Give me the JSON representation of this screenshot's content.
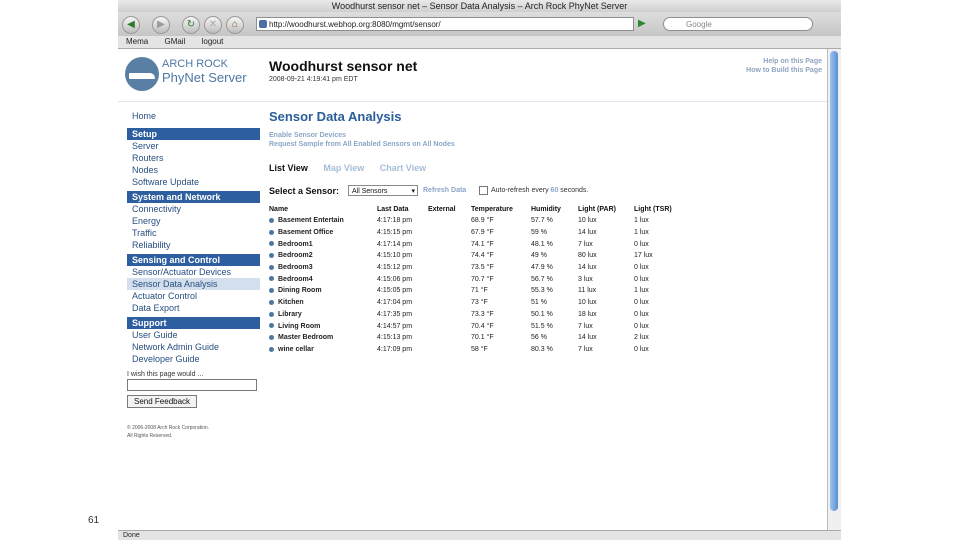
{
  "slide_number": "61",
  "browser": {
    "window_title": "Woodhurst sensor net – Sensor Data Analysis – Arch Rock PhyNet Server",
    "url": "http://woodhurst.webhop.org:8080/mgmt/sensor/",
    "search_placeholder": "Google",
    "bookmarks": [
      "Mema",
      "GMail",
      "logout"
    ],
    "status": "Done"
  },
  "header": {
    "logo_line1": "ARCH ROCK",
    "logo_line2": "PhyNet Server",
    "site_title": "Woodhurst sensor net",
    "timestamp": "2008-09-21 4:19:41 pm EDT",
    "help_links": [
      "Help on this Page",
      "How to Build this Page"
    ]
  },
  "sidebar": {
    "home": "Home",
    "sections": [
      {
        "title": "Setup",
        "items": [
          "Server",
          "Routers",
          "Nodes",
          "Software Update"
        ]
      },
      {
        "title": "System and Network",
        "items": [
          "Connectivity",
          "Energy",
          "Traffic",
          "Reliability"
        ]
      },
      {
        "title": "Sensing and Control",
        "items": [
          "Sensor/Actuator Devices",
          "Sensor Data Analysis",
          "Actuator Control",
          "Data Export"
        ]
      },
      {
        "title": "Support",
        "items": [
          "User Guide",
          "Network Admin Guide",
          "Developer Guide"
        ]
      }
    ],
    "feedback_label": "I wish this page would ...",
    "feedback_button": "Send Feedback",
    "copyright_line1": "© 2006-2008 Arch Rock Corporation.",
    "copyright_line2": "All Rights Reserved."
  },
  "main": {
    "title": "Sensor Data Analysis",
    "actions": [
      "Enable Sensor Devices",
      "Request Sample from All Enabled Sensors on All Nodes"
    ],
    "views": [
      "List View",
      "Map View",
      "Chart View"
    ],
    "sensor_label": "Select a Sensor:",
    "sensor_selected": "All Sensors",
    "refresh_label": "Refresh Data",
    "auto_refresh_prefix": "Auto-refresh every",
    "auto_refresh_value": "60",
    "auto_refresh_suffix": "seconds.",
    "columns": [
      "Name",
      "Last Data",
      "External",
      "Temperature",
      "Humidity",
      "Light (PAR)",
      "Light (TSR)"
    ],
    "rows": [
      [
        "Basement Entertain",
        "4:17:18 pm",
        "",
        "68.9 °F",
        "57.7 %",
        "10 lux",
        "1 lux"
      ],
      [
        "Basement Office",
        "4:15:15 pm",
        "",
        "67.9 °F",
        "59 %",
        "14 lux",
        "1 lux"
      ],
      [
        "Bedroom1",
        "4:17:14 pm",
        "",
        "74.1 °F",
        "48.1 %",
        "7 lux",
        "0 lux"
      ],
      [
        "Bedroom2",
        "4:15:10 pm",
        "",
        "74.4 °F",
        "49 %",
        "80 lux",
        "17 lux"
      ],
      [
        "Bedroom3",
        "4:15:12 pm",
        "",
        "73.5 °F",
        "47.9 %",
        "14 lux",
        "0 lux"
      ],
      [
        "Bedroom4",
        "4:15:06 pm",
        "",
        "70.7 °F",
        "56.7 %",
        "3 lux",
        "0 lux"
      ],
      [
        "Dining Room",
        "4:15:05 pm",
        "",
        "71 °F",
        "55.3 %",
        "11 lux",
        "1 lux"
      ],
      [
        "Kitchen",
        "4:17:04 pm",
        "",
        "73 °F",
        "51 %",
        "10 lux",
        "0 lux"
      ],
      [
        "Library",
        "4:17:35 pm",
        "",
        "73.3 °F",
        "50.1 %",
        "18 lux",
        "0 lux"
      ],
      [
        "Living Room",
        "4:14:57 pm",
        "",
        "70.4 °F",
        "51.5 %",
        "7 lux",
        "0 lux"
      ],
      [
        "Master Bedroom",
        "4:15:13 pm",
        "",
        "70.1 °F",
        "56 %",
        "14 lux",
        "2 lux"
      ],
      [
        "wine cellar",
        "4:17:09 pm",
        "",
        "58 °F",
        "80.3 %",
        "7 lux",
        "0 lux"
      ]
    ]
  }
}
